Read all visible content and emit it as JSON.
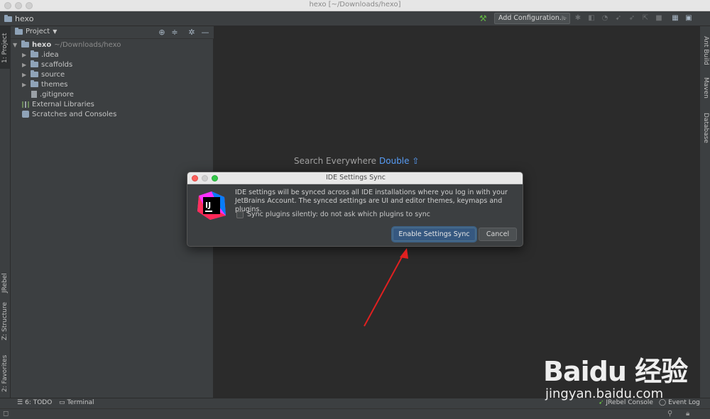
{
  "window": {
    "title": "hexo [~/Downloads/hexo]"
  },
  "navbar": {
    "project": "hexo",
    "add_configuration": "Add Configuration..."
  },
  "left_stripe": {
    "project_tab": "1: Project",
    "jrebel_tab": "JRebel",
    "structure_tab": "Z: Structure",
    "favorites_tab": "2: Favorites"
  },
  "right_stripe": {
    "ant_tab": "Ant Build",
    "maven_tab": "Maven",
    "database_tab": "Database"
  },
  "project_panel": {
    "title": "Project",
    "tree": {
      "root": {
        "name": "hexo",
        "path": "~/Downloads/hexo"
      },
      "children": [
        {
          "name": ".idea"
        },
        {
          "name": "scaffolds"
        },
        {
          "name": "source"
        },
        {
          "name": "themes"
        },
        {
          "name": ".gitignore"
        }
      ],
      "external_libraries": "External Libraries",
      "scratches": "Scratches and Consoles"
    }
  },
  "editor": {
    "search_label": "Search Everywhere",
    "search_shortcut": "Double ⇧"
  },
  "dialog": {
    "title": "IDE Settings Sync",
    "message_line1": "IDE settings will be synced across all IDE installations where you log in with your",
    "message_line2": "JetBrains Account. The synced settings are UI and editor themes, keymaps and plugins.",
    "checkbox_label": "Sync plugins silently: do not ask which plugins to sync",
    "checkbox_checked": false,
    "primary_button": "Enable Settings Sync",
    "cancel_button": "Cancel"
  },
  "bottom_bar": {
    "todo": "6: TODO",
    "terminal": "Terminal",
    "jrebel_console": "JRebel Console",
    "event_log": "Event Log"
  },
  "watermark": {
    "brand": "Baidu 经验",
    "url": "jingyan.baidu.com"
  },
  "colors": {
    "accent": "#589df6",
    "primary_button": "#365880",
    "annotation_arrow": "#e02020"
  }
}
